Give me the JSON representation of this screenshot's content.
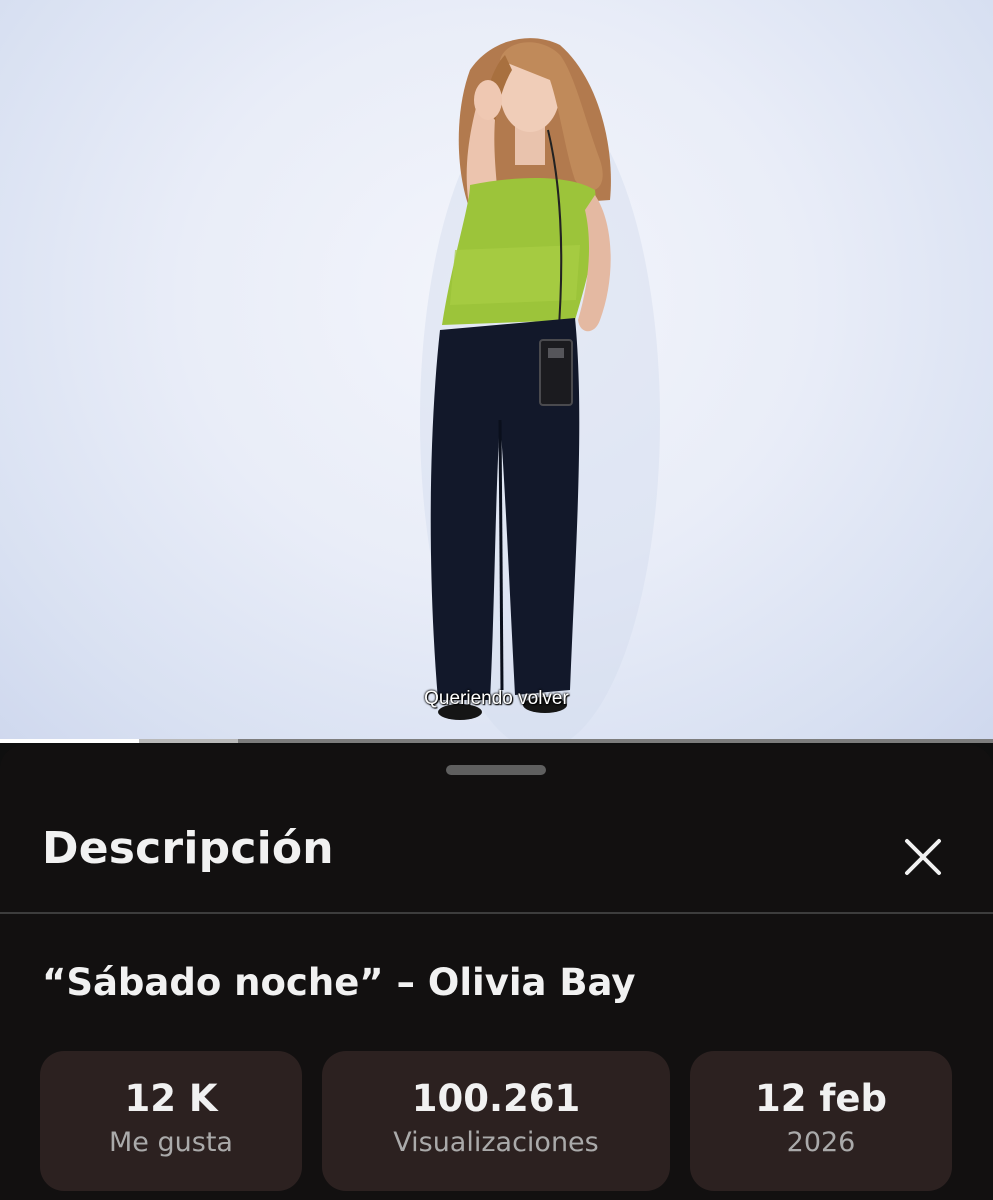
{
  "video": {
    "subtitle": "Queriendo volver",
    "progress_fraction": 0.14,
    "buffer_fraction": 0.24
  },
  "sheet": {
    "title": "Descripción",
    "close_icon": "close-icon"
  },
  "description": {
    "video_title": "“Sábado noche” – Olivia Bay",
    "stats": [
      {
        "value": "12 K",
        "label": "Me gusta"
      },
      {
        "value": "100.261",
        "label": "Visualizaciones"
      },
      {
        "value": "12 feb",
        "label": "2026"
      }
    ]
  },
  "colors": {
    "sheet_background": "#121010",
    "card_background": "#2c2120",
    "text_primary": "#f1f1f1",
    "text_secondary": "#aaaaaa"
  }
}
